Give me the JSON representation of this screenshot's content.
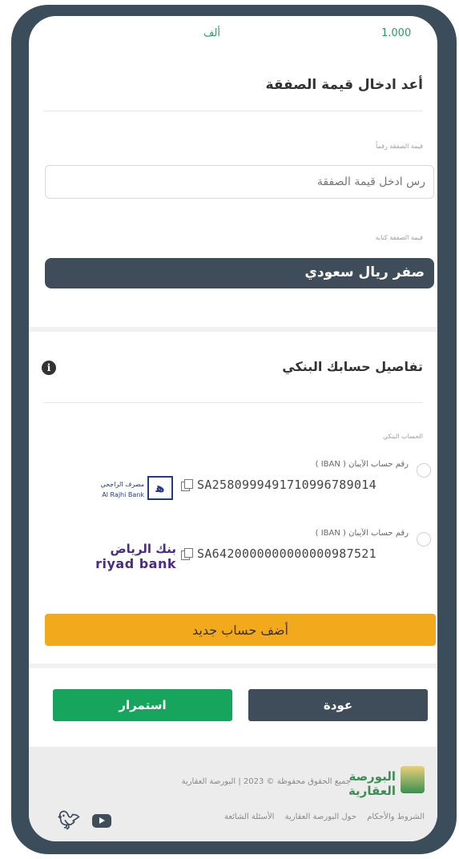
{
  "summary": {
    "amount": "1.000",
    "unit": "ألف"
  },
  "price_section": {
    "title": "أعد ادخال قيمة الصفقة",
    "input_label": "قيمة الصفقة رقماً",
    "input_placeholder": "رس ادخل قيمة الصفقة",
    "text_label": "قيمة الصفقة كتابة",
    "text_value": "صفر ريال سعودي"
  },
  "bank_section": {
    "title": "تفاصيل حسابك البنكي",
    "info_icon": "i",
    "accounts_label": "الحساب البنكي",
    "accounts": [
      {
        "iban_label": "رقم حساب الآيبان ( IBAN )",
        "iban": "SA2580999491710996789014",
        "bank_logo_ar": "مصرف الراجحي",
        "bank_logo_en": "Al Rajhi Bank",
        "bank_logo_mark": "ﻫ"
      },
      {
        "iban_label": "رقم حساب الآيبان ( IBAN )",
        "iban": "SA6420000000000000987521",
        "bank_logo_ar": "بنك الرياض",
        "bank_logo_en": "riyad bank"
      }
    ],
    "add_button": "أضف حساب جديد"
  },
  "actions": {
    "continue": "استمرار",
    "back": "عودة"
  },
  "footer": {
    "logo_text": "البورصة العقارية",
    "copyright": "جميع الحقوق محفوظة © 2023 | البورصة العقارية",
    "links": [
      "الشروط والأحكام",
      "حول البورصة العقارية",
      "الأسئلة الشائعة"
    ],
    "twitter_glyph": "🐦︎"
  },
  "colors": {
    "primary_dark": "#3f4d5a",
    "success": "#17a45c",
    "warning": "#f3a91c"
  },
  "icons": [
    "info-icon",
    "copy-icon",
    "twitter-icon",
    "youtube-icon",
    "radio-icon"
  ]
}
